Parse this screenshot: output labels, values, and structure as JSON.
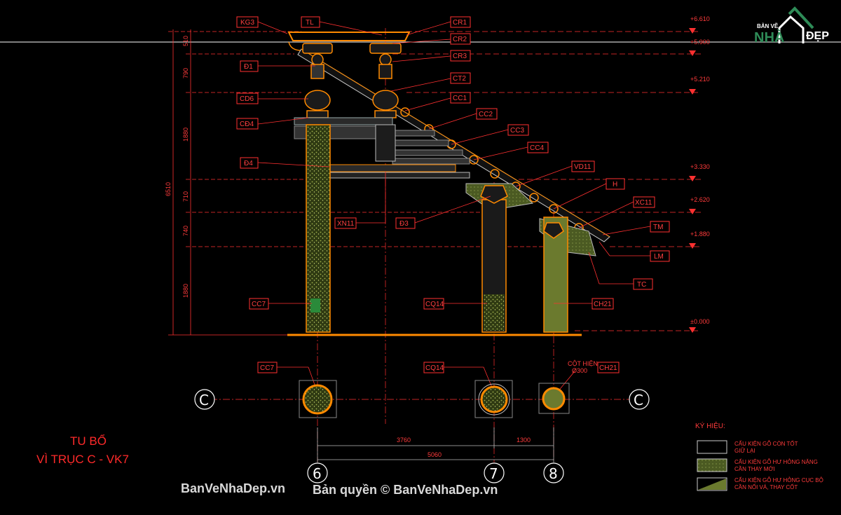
{
  "tags": [
    "KG3",
    "TL",
    "CR1",
    "CR2",
    "CR3",
    "Đ1",
    "CT2",
    "CD6",
    "CC1",
    "CĐ4",
    "CC2",
    "CC3",
    "CC4",
    "Đ4",
    "VD11",
    "H",
    "XC11",
    "XN11",
    "Đ3",
    "TM",
    "LM",
    "TC",
    "CC7",
    "CQ14",
    "CH21",
    "CC7",
    "CQ14",
    "CH21"
  ],
  "levels": [
    "+6.610",
    "+5.900",
    "+5.210",
    "+3.330",
    "+2.620",
    "+1.880",
    "±0.000"
  ],
  "vertical_dims": [
    "510",
    "790",
    "1880",
    "710",
    "740",
    "1880"
  ],
  "overall_dim": "6510",
  "horizontal_dims": [
    "3760",
    "1300",
    "5060"
  ],
  "axis_labels": [
    "6",
    "7",
    "8"
  ],
  "section_marks": [
    "C",
    "C"
  ],
  "note_cot_hien": "CỘT HIỆN",
  "note_size": "Ø300",
  "title": {
    "line1": "TU BỔ",
    "line2": "VÌ TRỤC C - VK7"
  },
  "legend": {
    "heading": "KÝ HIỆU:",
    "items": [
      {
        "line1": "CẤU KIỆN GỖ CÒN TỐT",
        "line2": "GIỮ LẠI"
      },
      {
        "line1": "CẤU KIỆN GỖ HƯ HỎNG NẶNG",
        "line2": "CẦN THAY MỚI"
      },
      {
        "line1": "CẤU KIỆN GỖ HƯ HỎNG CỤC BỘ",
        "line2": "CẦN NỐI VÁ, THAY CỐT"
      }
    ]
  },
  "watermark": {
    "left": "BanVeNhaDep.vn",
    "right": "Bản quyền © BanVeNhaDep.vn"
  },
  "logo": {
    "top": "BẢN VẼ",
    "main": "NHÀ",
    "tail": "ĐẸP"
  },
  "colors": {
    "red": "#ff3030",
    "orange": "#ff8a00",
    "olive": "#6b7a2e",
    "white": "#ffffff"
  }
}
